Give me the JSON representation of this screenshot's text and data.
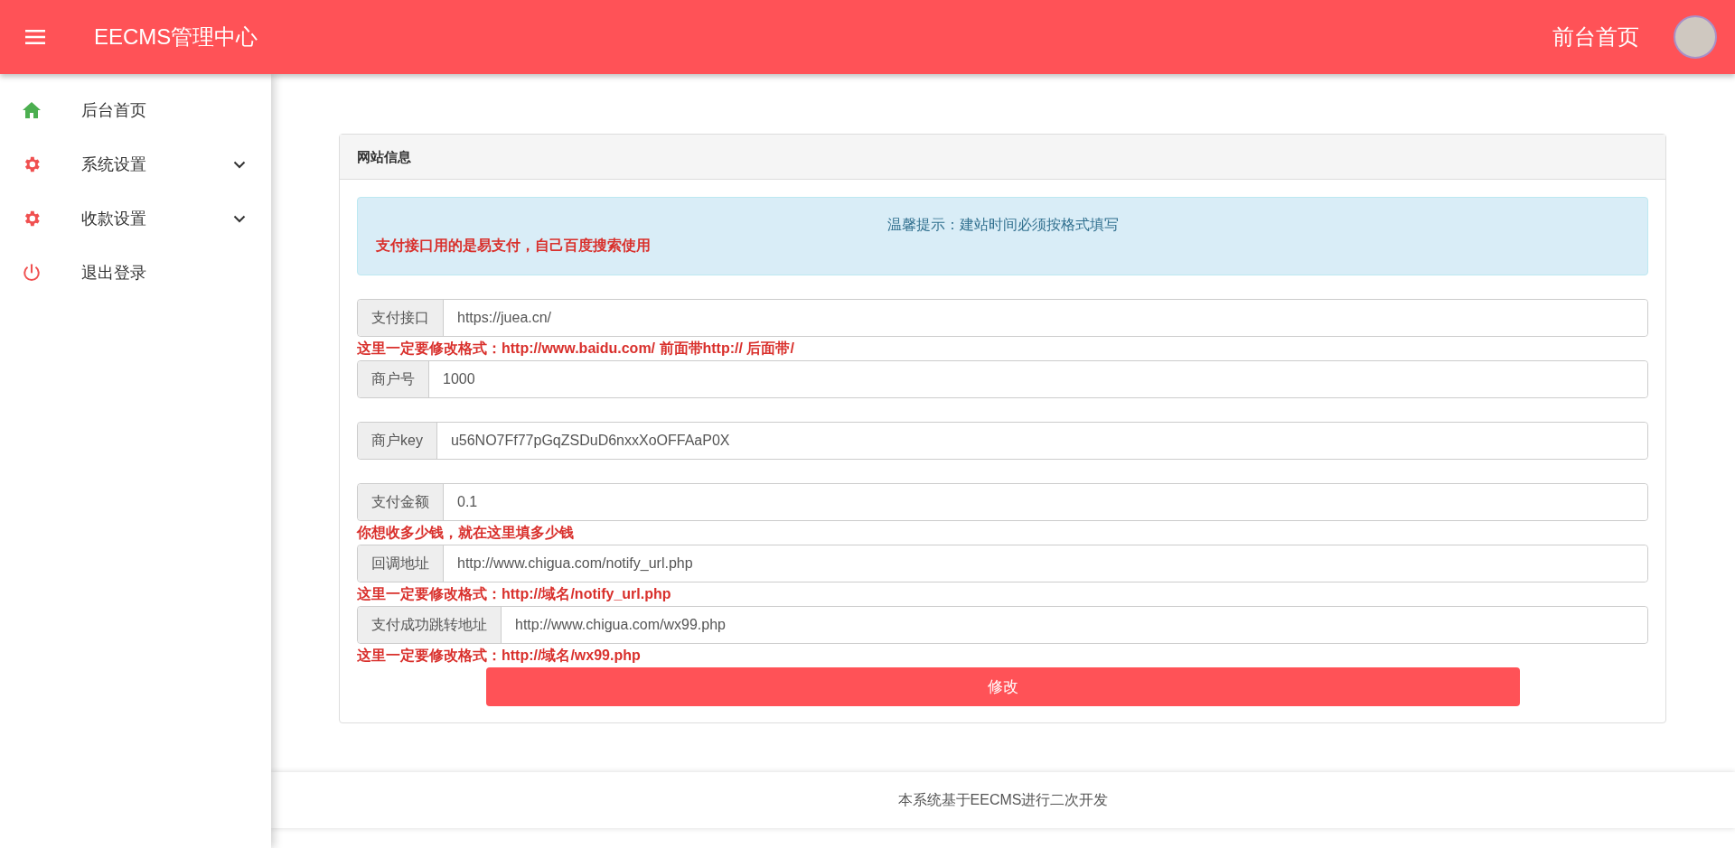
{
  "header": {
    "title": "EECMS管理中心",
    "link": "前台首页"
  },
  "sidebar": {
    "items": [
      {
        "label": "后台首页",
        "kind": "home",
        "has_submenu": false
      },
      {
        "label": "系统设置",
        "kind": "gear",
        "has_submenu": true
      },
      {
        "label": "收款设置",
        "kind": "gear",
        "has_submenu": true
      },
      {
        "label": "退出登录",
        "kind": "power",
        "has_submenu": false
      }
    ]
  },
  "card": {
    "title": "网站信息",
    "alert": {
      "notice": "温馨提示：建站时间必须按格式填写",
      "warning": "支付接口用的是易支付，自己百度搜索使用"
    },
    "fields": [
      {
        "label": "支付接口",
        "value": "https://juea.cn/",
        "note": "这里一定要修改格式：http://www.baidu.com/ 前面带http:// 后面带/"
      },
      {
        "label": "商户号",
        "value": "1000"
      },
      {
        "label": "商户key",
        "value": "u56NO7Ff77pGqZSDuD6nxxXoOFFAaP0X"
      },
      {
        "label": "支付金额",
        "value": "0.1",
        "note": "你想收多少钱，就在这里填多少钱"
      },
      {
        "label": "回调地址",
        "value": "http://www.chigua.com/notify_url.php",
        "note": "这里一定要修改格式：http://域名/notify_url.php"
      },
      {
        "label": "支付成功跳转地址",
        "value": "http://www.chigua.com/wx99.php",
        "note": "这里一定要修改格式：http://域名/wx99.php"
      }
    ],
    "submit": "修改"
  },
  "footer": "本系统基于EECMS进行二次开发"
}
